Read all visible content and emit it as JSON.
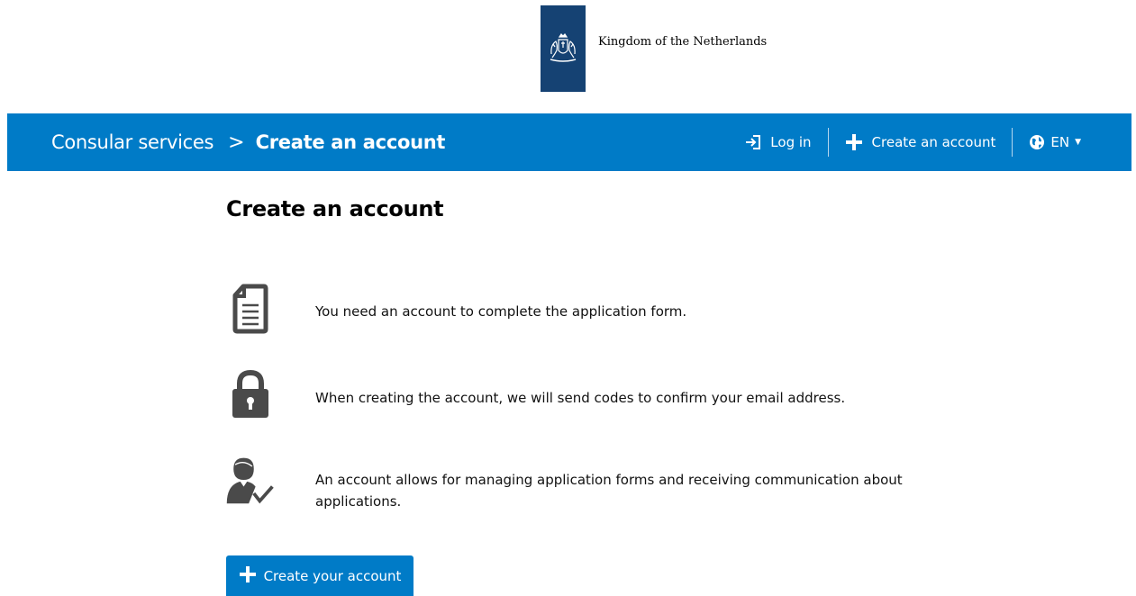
{
  "header": {
    "org_name": "Kingdom of the Netherlands",
    "brand_color": "#154273"
  },
  "navbar": {
    "bg_color": "#007bc7",
    "breadcrumb_home": "Consular services",
    "breadcrumb_separator": ">",
    "breadcrumb_current": "Create an account",
    "login_label": "Log in",
    "create_account_label": "Create an account",
    "language_label": "EN"
  },
  "main": {
    "title": "Create an account",
    "items": [
      {
        "icon": "document-icon",
        "text": "You need an account to complete the application form."
      },
      {
        "icon": "lock-icon",
        "text": "When creating the account, we will send codes to confirm your email address."
      },
      {
        "icon": "user-check-icon",
        "text": "An account allows for managing application forms and receiving communication about applications."
      }
    ],
    "cta_label": "Create your account"
  }
}
